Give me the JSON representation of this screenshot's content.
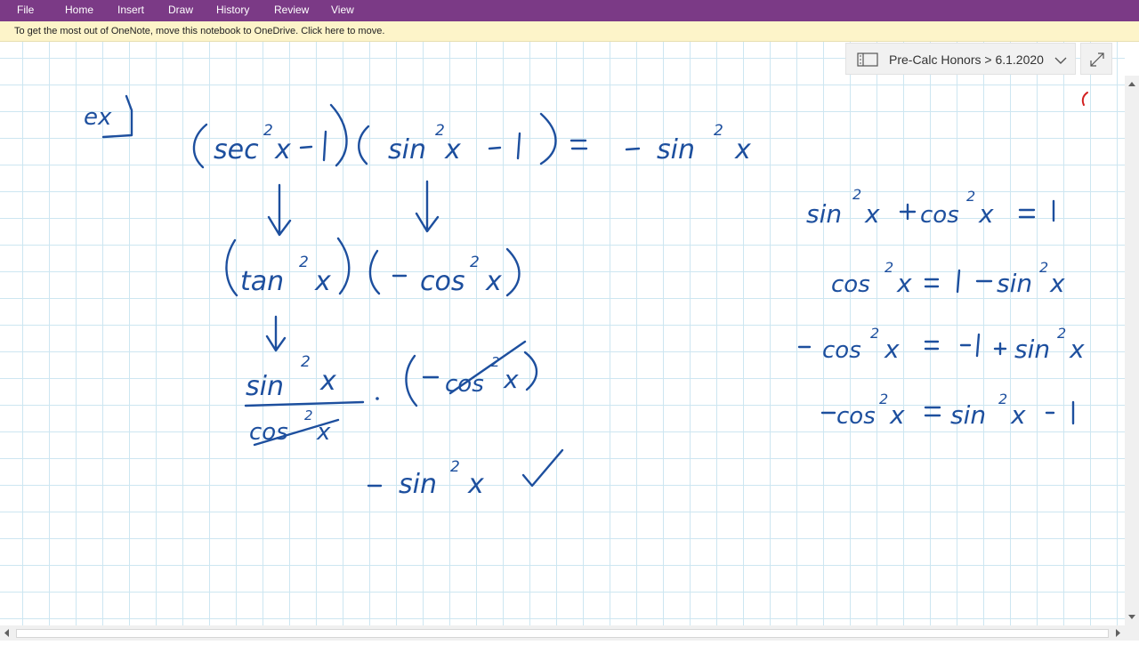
{
  "ribbon": {
    "tabs": [
      "File",
      "Home",
      "Insert",
      "Draw",
      "History",
      "Review",
      "View"
    ],
    "color": "#7b3a86"
  },
  "infobar": {
    "message": "To get the most out of OneNote, move this notebook to OneDrive. Click here to move.",
    "color": "#fdf4c9"
  },
  "breadcrumb": {
    "notebook": "Pre-Calc Honors",
    "separator": ">",
    "page": "6.1.2020"
  },
  "icons": {
    "notebook": "notebook-icon",
    "dropdown": "chevron-down-icon",
    "expand": "expand-icon"
  },
  "ink": {
    "color": "#1d4f9e",
    "example_label": "ex",
    "problem": "(sec²x − 1)(sin²x − 1) = − sin²x",
    "step1": "(tan²x) (− cos²x)",
    "step2_fraction": "sin²x / cos²x · (− cos²x)",
    "result": "− sin²x ✓",
    "identities": [
      "sin²x + cos²x = 1",
      "cos²x = 1 − sin²x",
      "− cos²x = −1 + sin²x",
      "−cos²x = sin²x − 1"
    ]
  }
}
